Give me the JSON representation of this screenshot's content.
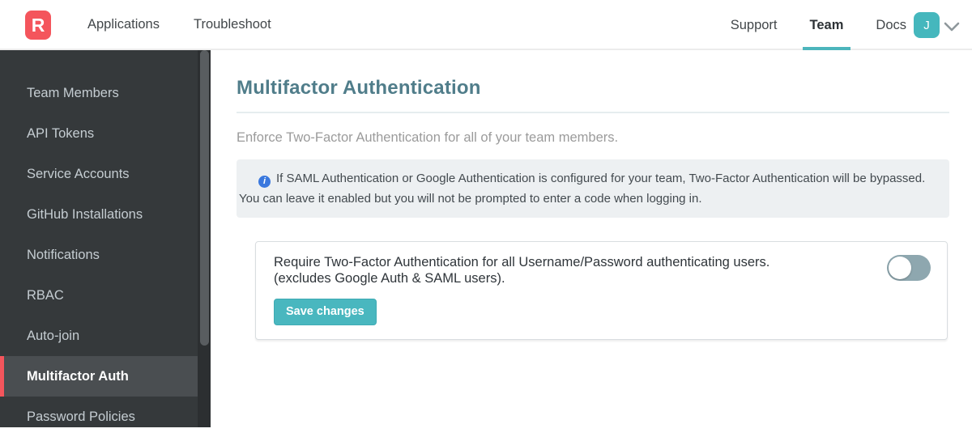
{
  "navbar": {
    "logo_letter": "R",
    "left_links": [
      {
        "label": "Applications"
      },
      {
        "label": "Troubleshoot"
      }
    ],
    "right_links": [
      {
        "label": "Support",
        "active": false
      },
      {
        "label": "Team",
        "active": true
      },
      {
        "label": "Docs",
        "active": false
      }
    ],
    "avatar_initial": "J"
  },
  "sidebar": {
    "items": [
      {
        "label": "Team Members",
        "active": false
      },
      {
        "label": "API Tokens",
        "active": false
      },
      {
        "label": "Service Accounts",
        "active": false
      },
      {
        "label": "GitHub Installations",
        "active": false
      },
      {
        "label": "Notifications",
        "active": false
      },
      {
        "label": "RBAC",
        "active": false
      },
      {
        "label": "Auto-join",
        "active": false
      },
      {
        "label": "Multifactor Auth",
        "active": true
      },
      {
        "label": "Password Policies",
        "active": false
      }
    ]
  },
  "main": {
    "title": "Multifactor Authentication",
    "subtitle": "Enforce Two-Factor Authentication for all of your team members.",
    "alert": {
      "icon": "info-icon",
      "icon_glyph": "i",
      "text": "If SAML Authentication or Google Authentication is configured for your team, Two-Factor Authentication will be bypassed. You can leave it enabled but you will not be prompted to enter a code when logging in."
    },
    "setting": {
      "label_line1": "Require Two-Factor Authentication for all Username/Password authenticating users.",
      "label_line2": "(excludes Google Auth & SAML users).",
      "toggle_state": "off",
      "save_button_label": "Save changes"
    }
  },
  "colors": {
    "accent_teal": "#49b7bf",
    "brand_red": "#f4555c",
    "heading_teal": "#507d8a",
    "sidebar_bg": "#35393b",
    "sidebar_active_bg": "#4a4e51",
    "alert_bg": "#edf0f2",
    "info_icon_blue": "#3a78de",
    "toggle_track": "#8ea7af"
  }
}
